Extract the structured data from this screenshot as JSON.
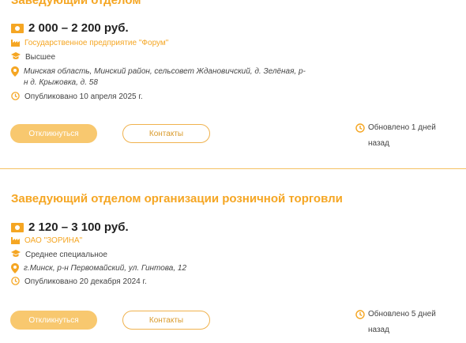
{
  "colors": {
    "accent": "#f5a623",
    "button_fill": "#f8c86f",
    "divider": "#f5c163",
    "text": "#444444"
  },
  "vacancies": [
    {
      "title": "Заведующий отделом",
      "salary": "2 000 – 2 200 руб.",
      "company": "Государственное предприятие \"Форум\"",
      "education": "Высшее",
      "address": "Минская область, Минский район, сельсовет Ждановичский, д. Зелёная, р-н д. Крыжовка, д. 58",
      "published": "Опубликовано 10 апреля 2025 г.",
      "apply_label": "Откликнуться",
      "contacts_label": "Контакты",
      "updated": "Обновлено 1 дней назад"
    },
    {
      "title": "Заведующий отделом организации розничной торговли",
      "salary": "2 120 – 3 100 руб.",
      "company": "ОАО \"ЗОРИНА\"",
      "education": "Среднее специальное",
      "address": "г.Минск, р-н Первомайский, ул. Гинтова, 12",
      "published": "Опубликовано 20 декабря 2024 г.",
      "apply_label": "Откликнуться",
      "contacts_label": "Контакты",
      "updated": "Обновлено 5 дней назад"
    }
  ],
  "icons": {
    "salary": "money-icon",
    "company": "factory-icon",
    "education": "graduation-cap-icon",
    "address": "location-pin-icon",
    "published": "clock-icon",
    "updated": "clock-icon"
  }
}
